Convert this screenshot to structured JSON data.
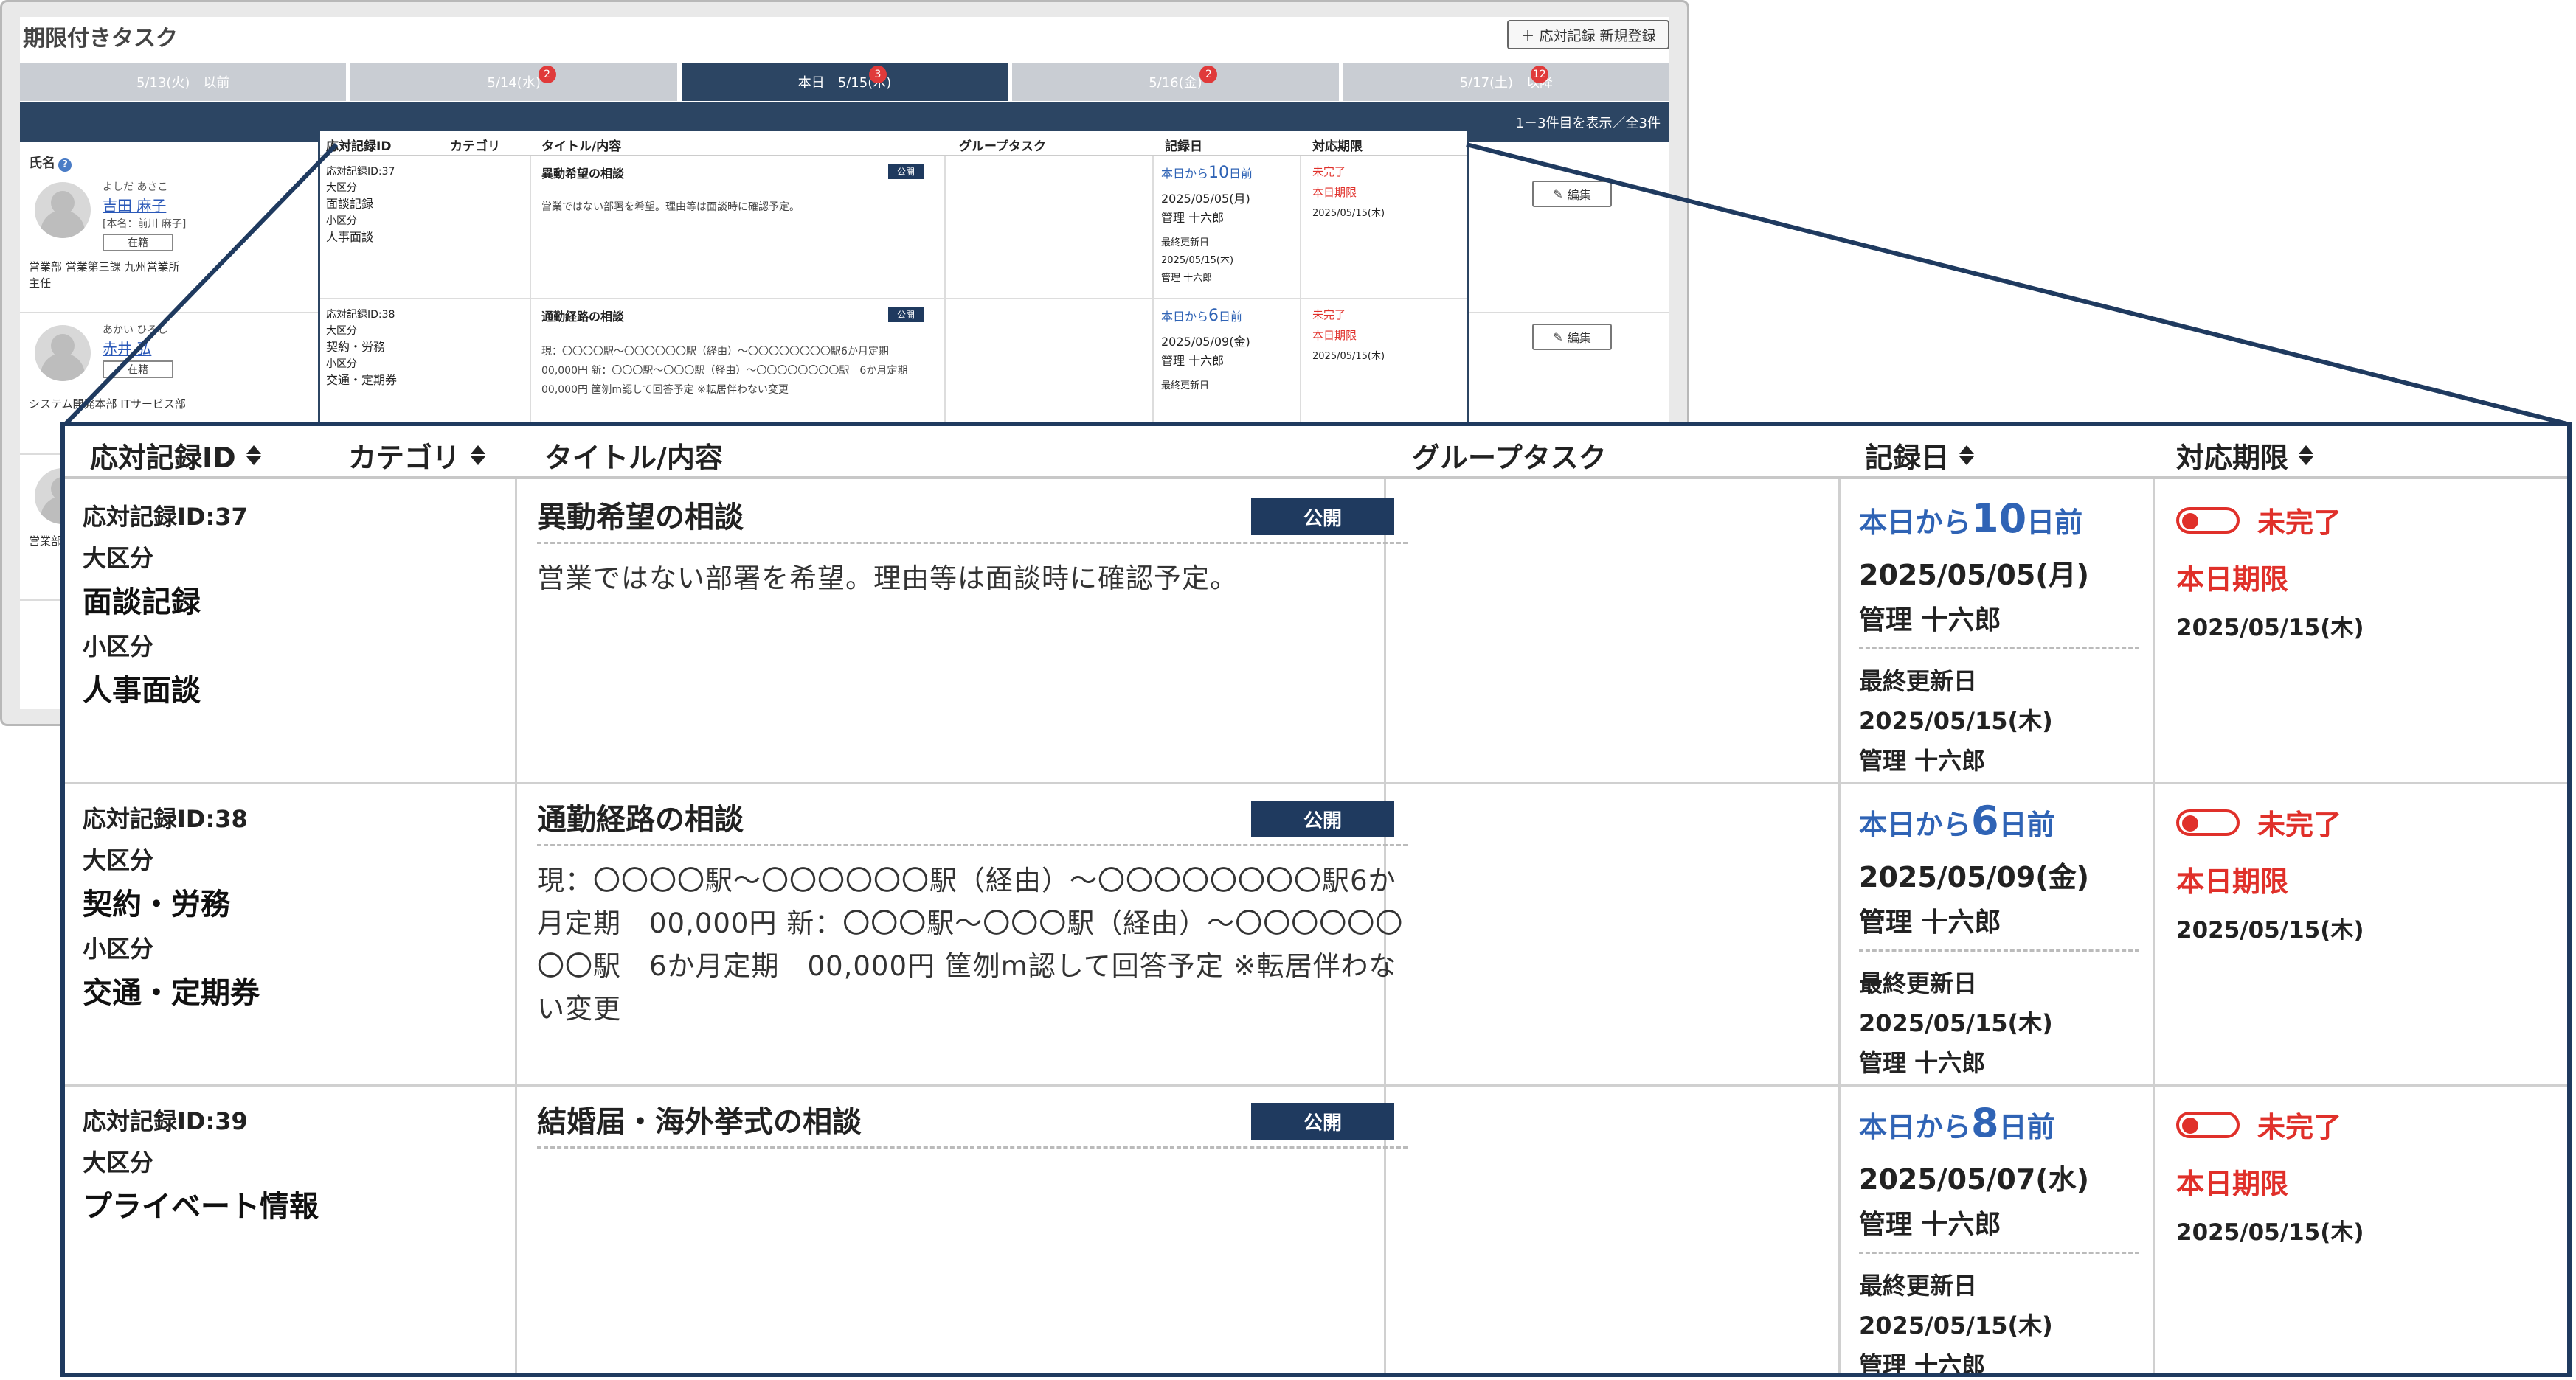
{
  "app": {
    "title": "期限付きタスク",
    "new_button": "＋ 応対記録 新規登録",
    "tabs": [
      {
        "label": "5/13(火)　以前",
        "badge": ""
      },
      {
        "label": "5/14(水)",
        "badge": "2"
      },
      {
        "label": "本日　5/15(木)",
        "badge": "3"
      },
      {
        "label": "5/16(金)",
        "badge": "2"
      },
      {
        "label": "5/17(土)　以降",
        "badge": "12"
      }
    ],
    "result_count": "1－3件目を表示／全3件",
    "name_header": "氏名",
    "edit_label": "編集"
  },
  "people": [
    {
      "kana": "よしだ あさこ",
      "name": "吉田 麻子",
      "honmei": "[本名：前川 麻子]",
      "status": "在籍",
      "dept": "営業部 営業第三課 九州営業所",
      "role": "主任"
    },
    {
      "kana": "あかい ひろし",
      "name": "赤井 弘",
      "honmei": "",
      "status": "在籍",
      "dept": "システム開発本部 ITサービス部",
      "role": ""
    },
    {
      "kana": "",
      "name": "",
      "honmei": "",
      "status": "",
      "dept": "営業部",
      "role": ""
    }
  ],
  "table": {
    "headers": {
      "id": "応対記録ID",
      "category": "カテゴリ",
      "title": "タイトル/内容",
      "group": "グループタスク",
      "record_date": "記録日",
      "due": "対応期限"
    },
    "rows": [
      {
        "rid": "応対記録ID:37",
        "major_label": "大区分",
        "major": "面談記録",
        "minor_label": "小区分",
        "minor": "人事面談",
        "title": "異動希望の相談",
        "public": "公開",
        "desc": "営業ではない部署を希望。理由等は面談時に確認予定。",
        "ago_pre": "本日から",
        "ago_num": "10",
        "ago_post": "日前",
        "date": "2025/05/05(月)",
        "who": "管理 十六郎",
        "upd_label": "最終更新日",
        "upd_date": "2025/05/15(木)",
        "upd_who": "管理 十六郎",
        "status": "未完了",
        "today": "本日期限",
        "due_date": "2025/05/15(木)"
      },
      {
        "rid": "応対記録ID:38",
        "major_label": "大区分",
        "major": "契約・労務",
        "minor_label": "小区分",
        "minor": "交通・定期券",
        "title": "通勤経路の相談",
        "public": "公開",
        "desc": "現：〇〇〇〇駅～〇〇〇〇〇〇駅（経由）～〇〇〇〇〇〇〇〇駅6か月定期　00,000円 新：〇〇〇駅～〇〇〇駅（経由）～〇〇〇〇〇〇〇〇駅　6か月定期　00,000円 筐刎m認して回答予定 ※転居伴わない変更",
        "ago_pre": "本日から",
        "ago_num": "6",
        "ago_post": "日前",
        "date": "2025/05/09(金)",
        "who": "管理 十六郎",
        "upd_label": "最終更新日",
        "upd_date": "2025/05/15(木)",
        "upd_who": "管理 十六郎",
        "status": "未完了",
        "today": "本日期限",
        "due_date": "2025/05/15(木)"
      },
      {
        "rid": "応対記録ID:39",
        "major_label": "大区分",
        "major": "プライベート情報",
        "minor_label": "",
        "minor": "",
        "title": "結婚届・海外挙式の相談",
        "public": "公開",
        "desc": "",
        "ago_pre": "本日から",
        "ago_num": "8",
        "ago_post": "日前",
        "date": "2025/05/07(水)",
        "who": "管理 十六郎",
        "upd_label": "最終更新日",
        "upd_date": "2025/05/15(木)",
        "upd_who": "管理 十六郎",
        "status": "未完了",
        "today": "本日期限",
        "due_date": "2025/05/15(木)"
      }
    ]
  },
  "colors": {
    "navy": "#1f3a5f",
    "header_bar": "#2c4563",
    "danger": "#e0302a",
    "link": "#2f63b5"
  }
}
